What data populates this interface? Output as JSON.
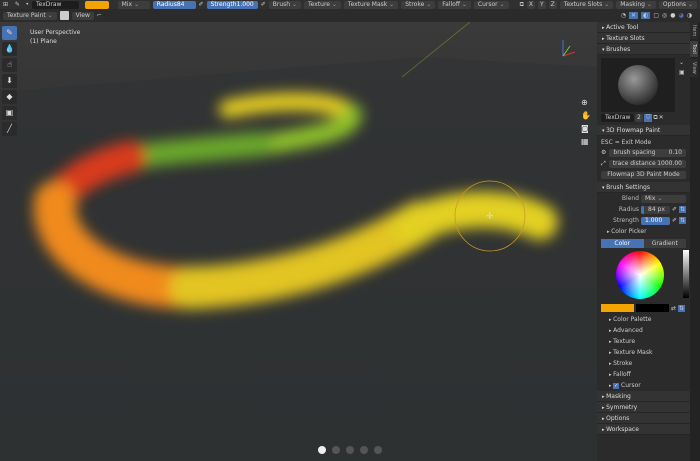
{
  "header": {
    "brush_name": "TexDraw",
    "color": "#f5a300",
    "blend": "Mix",
    "radius_label": "Radius",
    "radius": "84 px",
    "strength_label": "Strength",
    "strength": "1.000",
    "menus": [
      "Brush",
      "Texture",
      "Texture Mask",
      "Stroke",
      "Falloff",
      "Cursor"
    ],
    "axes": [
      "X",
      "Y",
      "Z"
    ],
    "right_menus": [
      "Texture Slots",
      "Masking",
      "Options"
    ]
  },
  "header2": {
    "mode": "Texture Paint",
    "view": "View"
  },
  "viewport": {
    "perspective": "User Perspective",
    "object": "(1) Plane",
    "stroke_colors": [
      "#e8d020",
      "#4caf2a",
      "#d83a1e",
      "#f08a1e",
      "#e2d024"
    ]
  },
  "toolbar": {
    "icons": [
      "brush-icon",
      "fill-icon",
      "smear-icon",
      "clone-icon",
      "mask-icon",
      "annotate-icon",
      "line-icon"
    ]
  },
  "sidebar": {
    "panels_top": [
      "Active Tool",
      "Texture Slots",
      "Brushes"
    ],
    "brush": {
      "name": "TexDraw",
      "users": "2"
    },
    "flowmap": {
      "title": "3D Flowmap Paint",
      "hint": "ESC = Exit Mode",
      "spacing_label": "brush spacing",
      "spacing": "0.10",
      "trace_label": "trace distance",
      "trace": "1000.00",
      "mode_button": "Flowmap 3D Paint Mode"
    },
    "brush_settings": {
      "title": "Brush Settings",
      "blend_label": "Blend",
      "blend": "Mix",
      "radius_label": "Radius",
      "radius": "84 px",
      "strength_label": "Strength",
      "strength": "1.000"
    },
    "color_picker": {
      "title": "Color Picker",
      "tab_color": "Color",
      "tab_gradient": "Gradient"
    },
    "subpanels": [
      "Color Palette",
      "Advanced",
      "Texture",
      "Texture Mask",
      "Stroke",
      "Falloff"
    ],
    "cursor_label": "Cursor",
    "panels_bottom": [
      "Masking",
      "Symmetry",
      "Options",
      "Workspace"
    ]
  },
  "tabs": [
    "Item",
    "Tool",
    "View"
  ]
}
